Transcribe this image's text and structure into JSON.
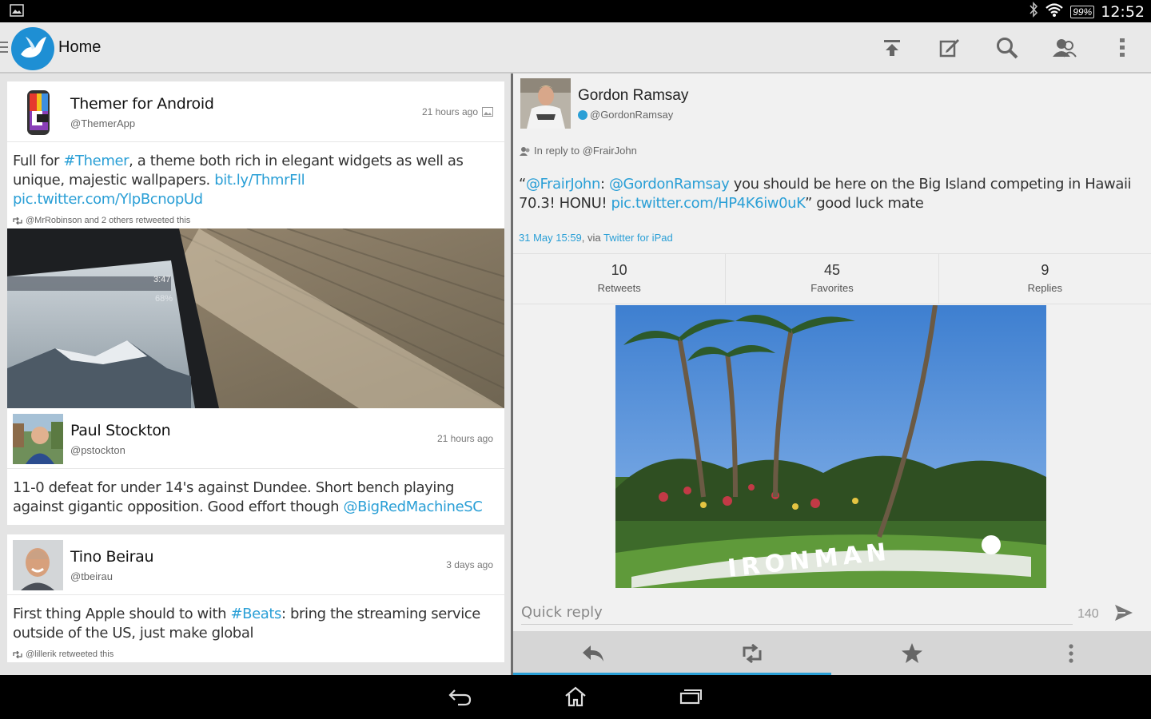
{
  "status_bar": {
    "time": "12:52",
    "battery": "99%"
  },
  "action_bar": {
    "title": "Home"
  },
  "timeline": [
    {
      "name": "Themer for Android",
      "handle": "@ThemerApp",
      "time": "21 hours ago",
      "text_parts": [
        "Full for ",
        "#Themer",
        ", a theme both rich in elegant widgets as well as unique, majestic wallpapers. ",
        "bit.ly/ThmrFll",
        " ",
        "pic.twitter.com/YlpBcnopUd"
      ],
      "retweet_info": "@MrRobinson and 2 others retweeted this",
      "media_phone_time": "3:47",
      "media_phone_battery": "68%"
    },
    {
      "name": "Paul Stockton",
      "handle": "@pstockton",
      "time": "21 hours ago",
      "text_parts": [
        "11-0 defeat for under 14's against Dundee. Short bench playing against gigantic opposition. Good effort though ",
        "@BigRedMachineSC"
      ]
    },
    {
      "name": "Tino Beirau",
      "handle": "@tbeirau",
      "time": "3 days ago",
      "text_parts": [
        "First thing Apple should to with ",
        "#Beats",
        ": bring the streaming service outside of the US, just make global"
      ],
      "retweet_info": "@lillerik retweeted this"
    }
  ],
  "detail": {
    "name": "Gordon Ramsay",
    "handle": "@GordonRamsay",
    "in_reply": "In reply to @FrairJohn",
    "text_parts": [
      "“",
      "@FrairJohn",
      ": ",
      "@GordonRamsay",
      " you should be here on the Big Island competing in Hawaii 70.3! HONU! ",
      "pic.twitter.com/HP4K6iw0uK",
      "” good luck mate"
    ],
    "date": "31 May 15:59",
    "via_sep": ", via ",
    "via": "Twitter for iPad",
    "stats": [
      {
        "num": "10",
        "label": "Retweets"
      },
      {
        "num": "45",
        "label": "Favorites"
      },
      {
        "num": "9",
        "label": "Replies"
      }
    ],
    "photo_text": "IRONMAN"
  },
  "quick_reply": {
    "placeholder": "Quick reply",
    "count": "140"
  },
  "colors": {
    "link": "#2a9fd6",
    "action_bar": "#e9e9e9",
    "accent": "#2a9fd6"
  },
  "icons": [
    "gallery-icon",
    "bluetooth-icon",
    "wifi-icon",
    "menu-icon",
    "app-logo-bird",
    "scroll-top-icon",
    "compose-icon",
    "search-icon",
    "accounts-icon",
    "overflow-icon",
    "image-attachment-icon",
    "retweet-icon",
    "in-reply-icon",
    "verified-icon",
    "send-icon",
    "reply-icon",
    "star-icon",
    "back-nav-icon",
    "home-nav-icon",
    "recents-nav-icon"
  ]
}
